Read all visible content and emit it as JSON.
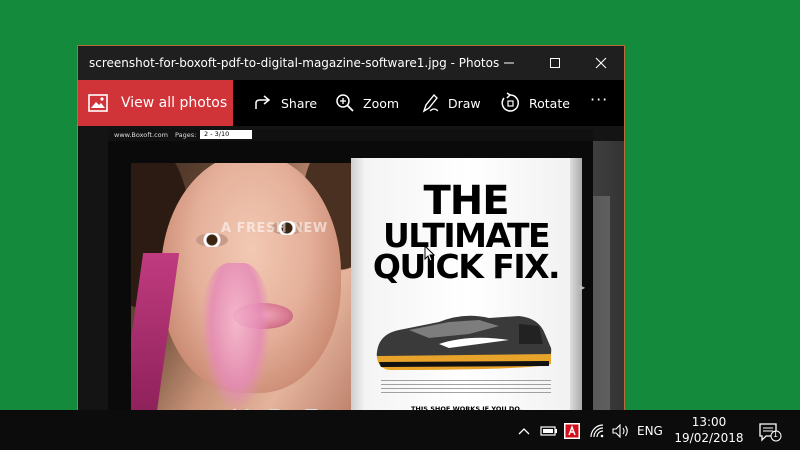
{
  "window": {
    "title": "screenshot-for-boxoft-pdf-to-digital-magazine-software1.jpg - Photos",
    "accent": "#d13438"
  },
  "toolbar": {
    "view_all": "View all photos",
    "share": "Share",
    "zoom": "Zoom",
    "draw": "Draw",
    "rotate": "Rotate",
    "more": "···"
  },
  "photo": {
    "site": "www.Boxoft.com",
    "pages_label": "Pages:",
    "pages_value": "2 - 3/10",
    "left_caption": "A FRESH NEW",
    "headline_1": "THE",
    "headline_2": "ULTIMATE",
    "headline_3": "QUICK FIX.",
    "subline": "THIS SHOE WORKS IF YOU DO.",
    "bottom_letters": "YBE"
  },
  "taskbar": {
    "language": "ENG",
    "time": "13:00",
    "date": "19/02/2018",
    "notification_count": "1"
  },
  "colors": {
    "desktop": "#138a3c",
    "taskbar": "#0c0c0c",
    "window_border": "#b96b3c"
  }
}
